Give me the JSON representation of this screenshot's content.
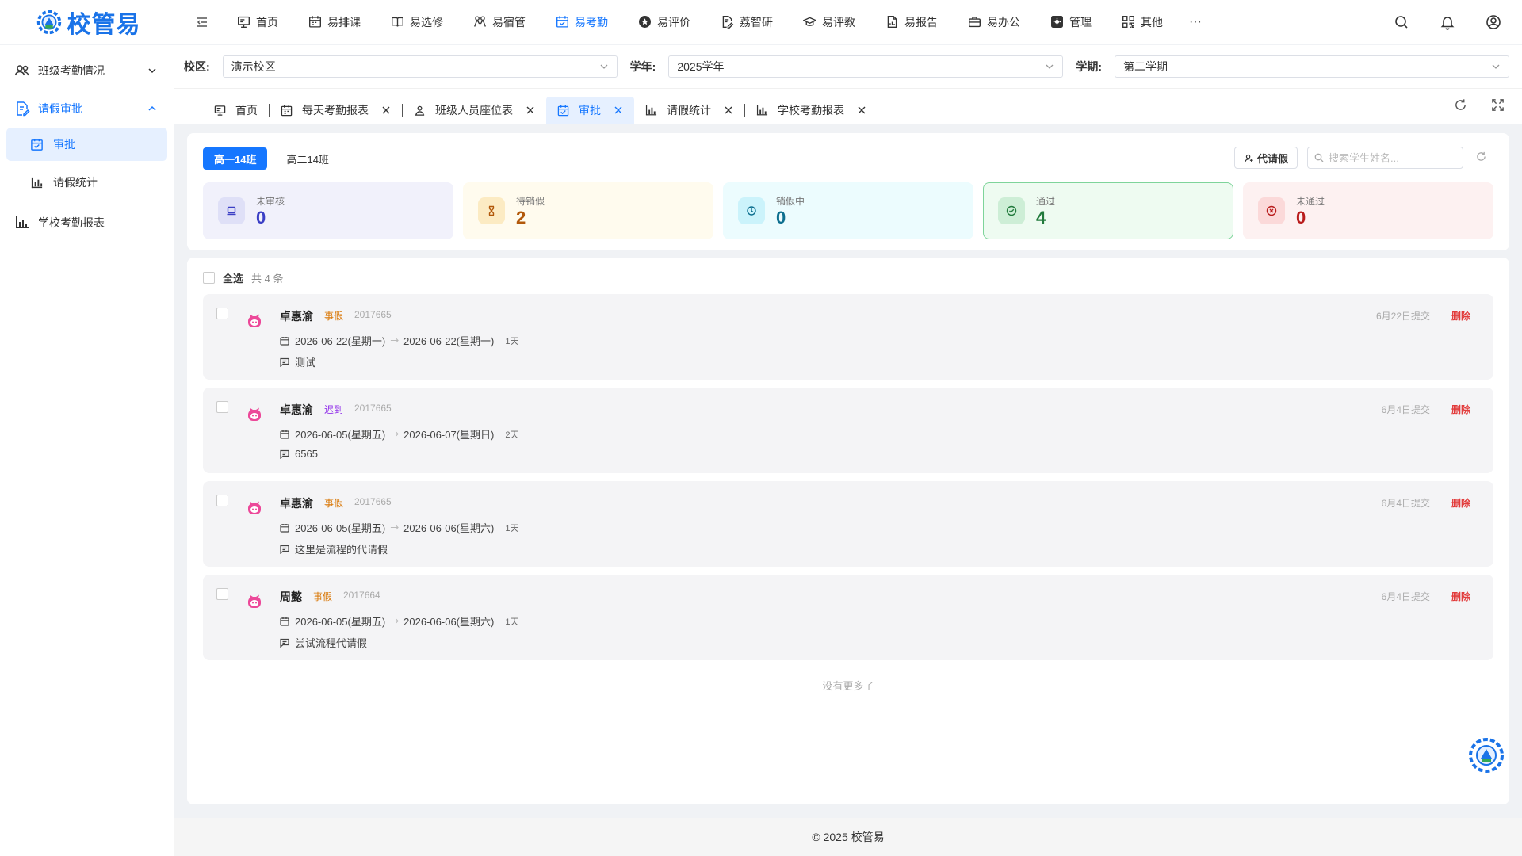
{
  "app": {
    "logo_text": "校管易"
  },
  "nav": [
    {
      "label": "首页",
      "icon": "monitor-icon"
    },
    {
      "label": "易排课",
      "icon": "calendar-grid-icon"
    },
    {
      "label": "易选修",
      "icon": "book-icon"
    },
    {
      "label": "易宿管",
      "icon": "people-icon"
    },
    {
      "label": "易考勤",
      "icon": "calendar-check-icon",
      "active": true
    },
    {
      "label": "易评价",
      "icon": "star-badge-icon"
    },
    {
      "label": "荔智研",
      "icon": "doc-edit-icon"
    },
    {
      "label": "易评教",
      "icon": "graduation-cap-icon"
    },
    {
      "label": "易报告",
      "icon": "report-icon"
    },
    {
      "label": "易办公",
      "icon": "briefcase-icon"
    },
    {
      "label": "管理",
      "icon": "gear-square-icon"
    },
    {
      "label": "其他",
      "icon": "apps-grid-icon"
    }
  ],
  "nav_more": "···",
  "sidebar": {
    "items": [
      {
        "label": "班级考勤情况"
      },
      {
        "label": "请假审批"
      },
      {
        "label": "审批"
      },
      {
        "label": "请假统计"
      },
      {
        "label": "学校考勤报表"
      }
    ]
  },
  "filters": {
    "campus_label": "校区:",
    "campus_value": "演示校区",
    "year_label": "学年:",
    "year_value": "2025学年",
    "term_label": "学期:",
    "term_value": "第二学期"
  },
  "tabs": [
    {
      "label": "首页"
    },
    {
      "label": "每天考勤报表"
    },
    {
      "label": "班级人员座位表"
    },
    {
      "label": "审批"
    },
    {
      "label": "请假统计"
    },
    {
      "label": "学校考勤报表"
    }
  ],
  "class_tabs": [
    "高一14班",
    "高二14班"
  ],
  "proxy_button": "代请假",
  "search_placeholder": "搜索学生姓名...",
  "stats": [
    {
      "label": "未审核",
      "value": "0",
      "color": "#3b3fc5",
      "bg": "#f1f1fb",
      "icon_bg": "#dfe0f7"
    },
    {
      "label": "待销假",
      "value": "2",
      "color": "#b2580a",
      "bg": "#fffbee",
      "icon_bg": "#fcebc3"
    },
    {
      "label": "销假中",
      "value": "0",
      "color": "#0d6f8f",
      "bg": "#ecfcfe",
      "icon_bg": "#cbf3fb"
    },
    {
      "label": "通过",
      "value": "4",
      "color": "#217a3c",
      "bg": "#eefbf1",
      "icon_bg": "#cdeed6",
      "border": "#7ed49a"
    },
    {
      "label": "未通过",
      "value": "0",
      "color": "#b91c1c",
      "bg": "#fdf1f1",
      "icon_bg": "#fbd9d9"
    }
  ],
  "list": {
    "select_all": "全选",
    "total": "共 4 条",
    "items": [
      {
        "name": "卓惠渝",
        "type": "事假",
        "type_color": "#d97706",
        "id": "2017665",
        "start": "2026-06-22(星期一)",
        "end": "2026-06-22(星期一)",
        "days": "1天",
        "remark": "测试",
        "submitted": "6月22日提交",
        "delete": "删除"
      },
      {
        "name": "卓惠渝",
        "type": "迟到",
        "type_color": "#9333ea",
        "id": "2017665",
        "start": "2026-06-05(星期五)",
        "end": "2026-06-07(星期日)",
        "days": "2天",
        "remark": "6565",
        "submitted": "6月4日提交",
        "delete": "删除"
      },
      {
        "name": "卓惠渝",
        "type": "事假",
        "type_color": "#d97706",
        "id": "2017665",
        "start": "2026-06-05(星期五)",
        "end": "2026-06-06(星期六)",
        "days": "1天",
        "remark": "这里是流程的代请假",
        "submitted": "6月4日提交",
        "delete": "删除"
      },
      {
        "name": "周懿",
        "type": "事假",
        "type_color": "#d97706",
        "id": "2017664",
        "start": "2026-06-05(星期五)",
        "end": "2026-06-06(星期六)",
        "days": "1天",
        "remark": "尝试流程代请假",
        "submitted": "6月4日提交",
        "delete": "删除"
      }
    ],
    "no_more": "没有更多了"
  },
  "footer": "© 2025 校管易",
  "colors": {
    "accent": "#1677ff",
    "delete": "#e23b3b",
    "avatar": "#ec4899"
  }
}
